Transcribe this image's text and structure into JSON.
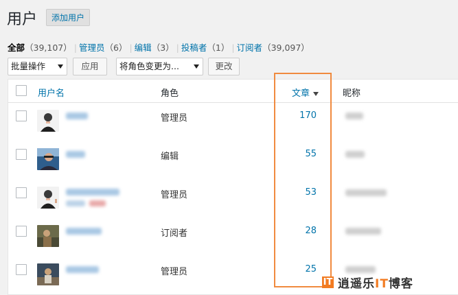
{
  "header": {
    "title": "用户",
    "add_new": "添加用户"
  },
  "views": [
    {
      "label": "全部",
      "count": "（39,107）"
    },
    {
      "label": "管理员",
      "count": "（6）"
    },
    {
      "label": "编辑",
      "count": "（3）"
    },
    {
      "label": "投稿者",
      "count": "（1）"
    },
    {
      "label": "订阅者",
      "count": "（39,097）"
    }
  ],
  "tablenav": {
    "bulk_action": "批量操作",
    "apply": "应用",
    "change_role": "将角色变更为...",
    "change": "更改"
  },
  "columns": {
    "username": "用户名",
    "role": "角色",
    "posts": "文章",
    "nickname": "昵称"
  },
  "rows": [
    {
      "role": "管理员",
      "posts": "170"
    },
    {
      "role": "编辑",
      "posts": "55"
    },
    {
      "role": "管理员",
      "posts": "53"
    },
    {
      "role": "订阅者",
      "posts": "28"
    },
    {
      "role": "管理员",
      "posts": "25"
    }
  ],
  "watermark": {
    "prefix": "逍遥乐",
    "it": "IT",
    "suffix": "博客",
    "box": "IT"
  },
  "colors": {
    "link": "#0073aa",
    "highlight": "#f08a3e",
    "brand": "#f27b21"
  }
}
